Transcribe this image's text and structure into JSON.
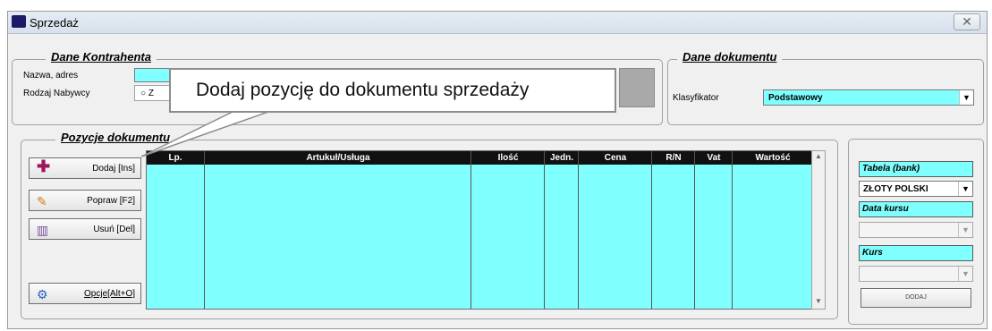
{
  "window": {
    "title": "Sprzedaż",
    "close_icon": "close-icon"
  },
  "kontrahent": {
    "legend": "Dane Kontrahenta",
    "name_label": "Nazwa, adres",
    "type_label": "Rodzaj Nabywcy",
    "radio_text": "Z"
  },
  "dokument": {
    "legend": "Dane dokumentu",
    "klasyfikator_label": "Klasyfikator",
    "klasyfikator_value": "Podstawowy"
  },
  "pozycje": {
    "legend": "Pozycje dokumentu",
    "buttons": [
      {
        "label": "Dodaj  [Ins]",
        "icon": "plus-icon"
      },
      {
        "label": "Popraw  [F2]",
        "icon": "pencil-icon"
      },
      {
        "label": "Usuń  [Del]",
        "icon": "trash-icon"
      },
      {
        "label": "Opcje[Alt+O]",
        "icon": "gear-icon"
      }
    ],
    "columns": [
      "Lp.",
      "Artukuł/Usługa",
      "Ilość",
      "Jedn.",
      "Cena",
      "R/N",
      "Vat",
      "Wartość"
    ]
  },
  "bank": {
    "tabela_label": "Tabela (bank)",
    "tabela_value": "ZŁOTY POLSKI",
    "data_kursu_label": "Data kursu",
    "kurs_label": "Kurs",
    "add_button": "DODAJ"
  },
  "callout": {
    "text": "Dodaj pozycję  do dokumentu sprzedaży"
  },
  "colors": {
    "field": "#80ffff",
    "header": "#111111",
    "window": "#f0f0f0"
  }
}
